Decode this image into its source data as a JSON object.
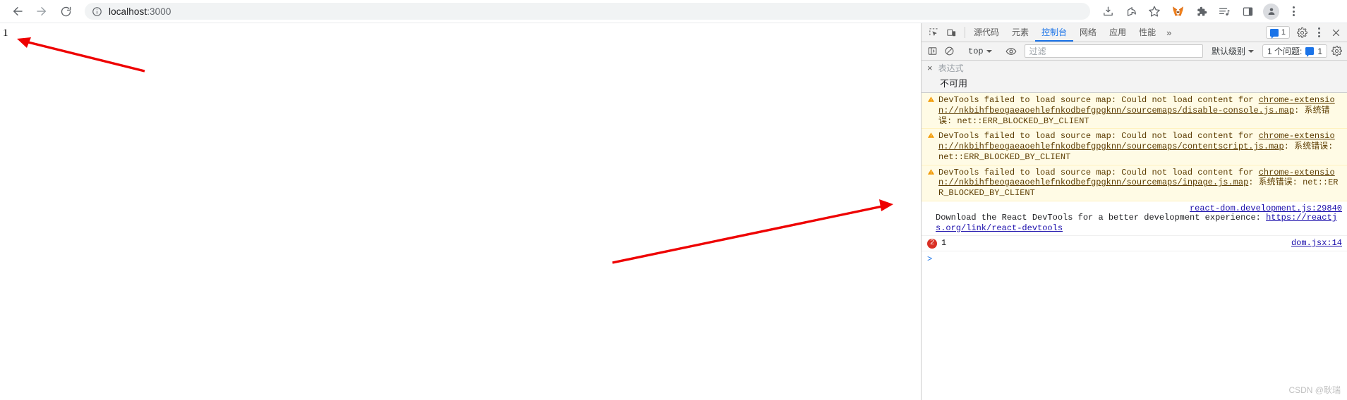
{
  "browser": {
    "nav": {
      "back_label": "Back",
      "forward_label": "Forward",
      "reload_label": "Reload"
    },
    "omnibox": {
      "host": "localhost",
      "port": ":3000",
      "full_url": "localhost:3000",
      "info_icon": "site-information-icon"
    },
    "toolbar_icons": [
      {
        "name": "install-app-icon",
        "label": "Install"
      },
      {
        "name": "share-icon",
        "label": "Share"
      },
      {
        "name": "bookmark-star-icon",
        "label": "Bookmark"
      },
      {
        "name": "metamask-extension-icon",
        "label": "MetaMask"
      },
      {
        "name": "extensions-puzzle-icon",
        "label": "Extensions"
      },
      {
        "name": "media-playlist-icon",
        "label": "Media"
      },
      {
        "name": "side-panel-icon",
        "label": "Side panel"
      },
      {
        "name": "profile-avatar-icon",
        "label": "Profile"
      },
      {
        "name": "chrome-menu-icon",
        "label": "Customize and control"
      }
    ]
  },
  "page": {
    "content_text": "1"
  },
  "devtools": {
    "tabs": [
      {
        "label": "源代码",
        "active": false
      },
      {
        "label": "元素",
        "active": false
      },
      {
        "label": "控制台",
        "active": true
      },
      {
        "label": "网络",
        "active": false
      },
      {
        "label": "应用",
        "active": false
      },
      {
        "label": "性能",
        "active": false
      }
    ],
    "more_tabs_label": "»",
    "issue_badge_count": "1",
    "settings_label": "设置",
    "close_label": "关闭",
    "console_toolbar": {
      "sidebar_toggle": "console-sidebar-icon",
      "clear_label": "清除控制台",
      "context": "top",
      "eye_label": "实时表达式",
      "filter_placeholder": "过滤",
      "filter_value": "",
      "level_label": "默认级别",
      "issues_text": "1 个问题:",
      "issues_count": "1",
      "settings_label": "控制台设置"
    },
    "watch": {
      "close_label": "×",
      "expression_placeholder": "表达式",
      "value": "不可用"
    },
    "messages": [
      {
        "type": "warning",
        "icon": "warning-triangle-icon",
        "parts": [
          {
            "text": "DevTools failed to load source map: Could not load content for ",
            "link": false
          },
          {
            "text": "chrome-extension://nkbihfbeogaeaoehlefnkodbefgpgknn/sourcemaps/disable-console.js.map",
            "link": true
          },
          {
            "text": ": 系统错误: net::ERR_BLOCKED_BY_CLIENT",
            "link": false
          }
        ],
        "source": ""
      },
      {
        "type": "warning",
        "icon": "warning-triangle-icon",
        "parts": [
          {
            "text": "DevTools failed to load source map: Could not load content for ",
            "link": false
          },
          {
            "text": "chrome-extension://nkbihfbeogaeaoehlefnkodbefgpgknn/sourcemaps/contentscript.js.map",
            "link": true
          },
          {
            "text": ": 系统错误: net::ERR_BLOCKED_BY_CLIENT",
            "link": false
          }
        ],
        "source": ""
      },
      {
        "type": "warning",
        "icon": "warning-triangle-icon",
        "parts": [
          {
            "text": "DevTools failed to load source map: Could not load content for ",
            "link": false
          },
          {
            "text": "chrome-extension://nkbihfbeogaeaoehlefnkodbefgpgknn/sourcemaps/inpage.js.map",
            "link": true
          },
          {
            "text": ": 系统错误: net::ERR_BLOCKED_BY_CLIENT",
            "link": false
          }
        ],
        "source": ""
      },
      {
        "type": "info",
        "icon": "",
        "parts": [
          {
            "text": "Download the React DevTools for a better development experience: ",
            "link": false
          },
          {
            "text": "https://reactjs.org/link/react-devtools",
            "link": true
          }
        ],
        "source": "react-dom.development.js:29840"
      },
      {
        "type": "error-grouped",
        "icon": "error-count-badge",
        "count": "2",
        "value": "1",
        "source": "dom.jsx:14"
      }
    ],
    "prompt_symbol": ">"
  },
  "annotations": {
    "arrow_color": "#ee0000",
    "arrows": [
      {
        "name": "arrow-to-page-output"
      },
      {
        "name": "arrow-to-console-error"
      }
    ]
  },
  "watermark": "CSDN @耿瑞",
  "colors": {
    "accent": "#1a73e8",
    "warning_bg": "#fffbe5",
    "warning_text": "#5c3c00",
    "error": "#d93025",
    "link": "#1a0dab"
  }
}
